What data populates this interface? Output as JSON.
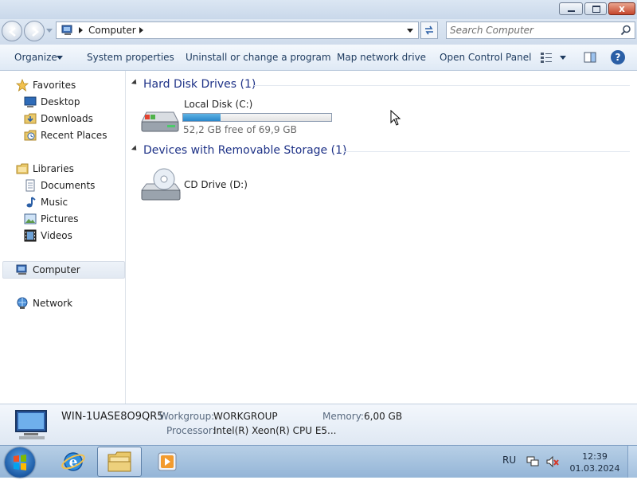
{
  "window": {
    "caption_buttons": {
      "minimize": "minimize",
      "maximize": "maximize",
      "close": "x"
    }
  },
  "address_bar": {
    "path": [
      "Computer"
    ],
    "refresh": "refresh"
  },
  "search": {
    "placeholder": "Search Computer"
  },
  "toolbar": {
    "organize": "Organize",
    "system_properties": "System properties",
    "uninstall": "Uninstall or change a program",
    "map_network_drive": "Map network drive",
    "open_control_panel": "Open Control Panel",
    "help": "?"
  },
  "nav_pane": {
    "favorites": {
      "label": "Favorites",
      "items": [
        {
          "label": "Desktop",
          "icon": "desktop-icon"
        },
        {
          "label": "Downloads",
          "icon": "downloads-folder-icon"
        },
        {
          "label": "Recent Places",
          "icon": "recent-places-icon"
        }
      ]
    },
    "libraries": {
      "label": "Libraries",
      "items": [
        {
          "label": "Documents",
          "icon": "documents-icon"
        },
        {
          "label": "Music",
          "icon": "music-icon"
        },
        {
          "label": "Pictures",
          "icon": "pictures-icon"
        },
        {
          "label": "Videos",
          "icon": "videos-icon"
        }
      ]
    },
    "computer": {
      "label": "Computer",
      "selected": true
    },
    "network": {
      "label": "Network"
    }
  },
  "content": {
    "groups": [
      {
        "title": "Hard Disk Drives (1)",
        "items": [
          {
            "name": "Local Disk (C:)",
            "free_text": "52,2 GB free of 69,9 GB",
            "used_fraction": 0.253
          }
        ]
      },
      {
        "title": "Devices with Removable Storage (1)",
        "items": [
          {
            "name": "CD Drive (D:)"
          }
        ]
      }
    ]
  },
  "details": {
    "computer_name": "WIN-1UASE8O9QR5",
    "workgroup_label": "Workgroup:",
    "workgroup": "WORKGROUP",
    "memory_label": "Memory:",
    "memory": "6,00 GB",
    "processor_label": "Processor:",
    "processor": "Intel(R) Xeon(R) CPU E5..."
  },
  "taskbar": {
    "apps": [
      "internet-explorer",
      "windows-explorer",
      "windows-media-player"
    ],
    "language": "RU",
    "time": "12:39",
    "date": "01.03.2024"
  },
  "colors": {
    "accent": "#1e3287",
    "selection": "#e2e9f2",
    "disk_bar": "#2a86c9"
  }
}
